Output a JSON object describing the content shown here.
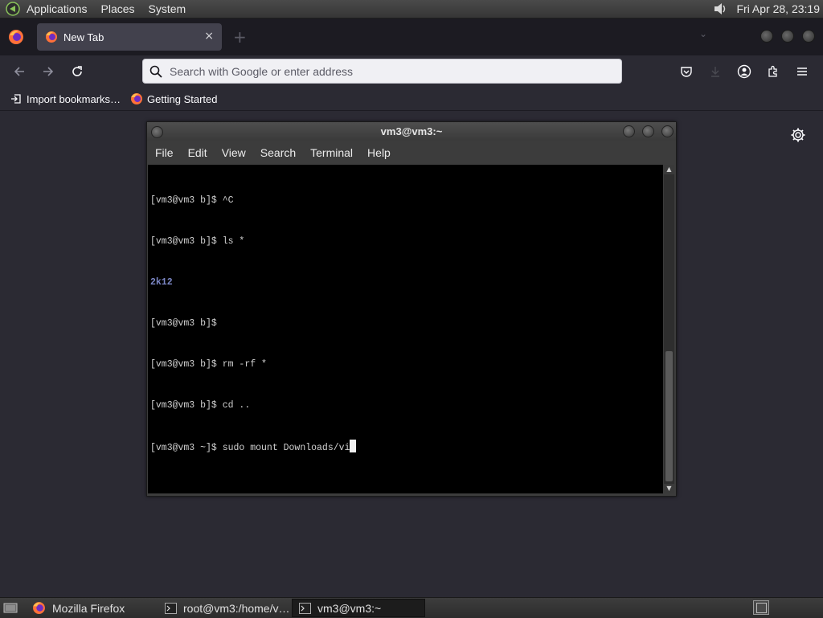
{
  "top_panel": {
    "menus": [
      "Applications",
      "Places",
      "System"
    ],
    "clock": "Fri Apr 28, 23:19"
  },
  "tabs": [
    {
      "title": "New Tab",
      "close": "×"
    }
  ],
  "new_tab_symbol": "+",
  "urlbar": {
    "placeholder": "Search with Google or enter address"
  },
  "bookmarks": [
    {
      "label": "Import bookmarks…"
    },
    {
      "label": "Getting Started"
    }
  ],
  "terminal": {
    "title": "vm3@vm3:~",
    "menu": [
      "File",
      "Edit",
      "View",
      "Search",
      "Terminal",
      "Help"
    ],
    "lines": [
      "[vm3@vm3 b]$ ^C",
      "[vm3@vm3 b]$ ls *",
      "2k12",
      "[vm3@vm3 b]$",
      "[vm3@vm3 b]$ rm -rf *",
      "[vm3@vm3 b]$ cd ..",
      "[vm3@vm3 ~]$ sudo mount Downloads/vi"
    ]
  },
  "taskbar": [
    {
      "label": "Mozilla Firefox",
      "icon": "firefox-icon",
      "active": false
    },
    {
      "label": "root@vm3:/home/v…",
      "icon": "terminal-icon",
      "active": false
    },
    {
      "label": "vm3@vm3:~",
      "icon": "terminal-icon",
      "active": true
    }
  ],
  "colors": {
    "browser_bg": "#2b2a33",
    "tabstrip_bg": "#1c1b22",
    "terminal_bg": "#000000",
    "terminal_fg": "#d0d0d0",
    "dir_color": "#7b86c4"
  }
}
